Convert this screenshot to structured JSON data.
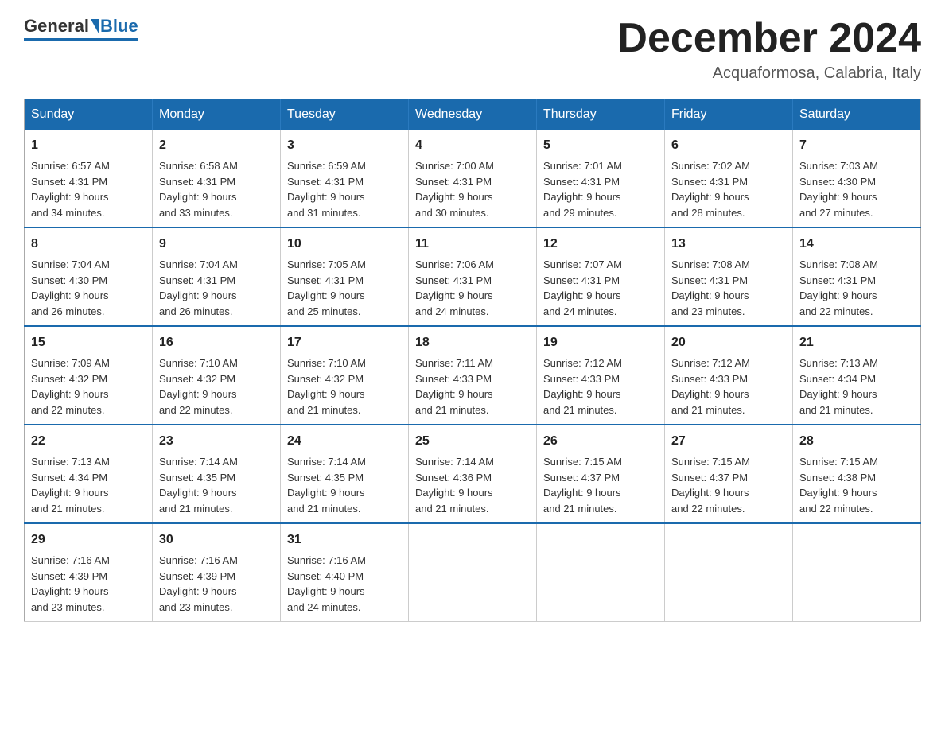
{
  "logo": {
    "general": "General",
    "blue": "Blue"
  },
  "header": {
    "month": "December 2024",
    "location": "Acquaformosa, Calabria, Italy"
  },
  "days_of_week": [
    "Sunday",
    "Monday",
    "Tuesday",
    "Wednesday",
    "Thursday",
    "Friday",
    "Saturday"
  ],
  "weeks": [
    [
      {
        "day": "1",
        "sunrise": "6:57 AM",
        "sunset": "4:31 PM",
        "daylight": "9 hours and 34 minutes."
      },
      {
        "day": "2",
        "sunrise": "6:58 AM",
        "sunset": "4:31 PM",
        "daylight": "9 hours and 33 minutes."
      },
      {
        "day": "3",
        "sunrise": "6:59 AM",
        "sunset": "4:31 PM",
        "daylight": "9 hours and 31 minutes."
      },
      {
        "day": "4",
        "sunrise": "7:00 AM",
        "sunset": "4:31 PM",
        "daylight": "9 hours and 30 minutes."
      },
      {
        "day": "5",
        "sunrise": "7:01 AM",
        "sunset": "4:31 PM",
        "daylight": "9 hours and 29 minutes."
      },
      {
        "day": "6",
        "sunrise": "7:02 AM",
        "sunset": "4:31 PM",
        "daylight": "9 hours and 28 minutes."
      },
      {
        "day": "7",
        "sunrise": "7:03 AM",
        "sunset": "4:30 PM",
        "daylight": "9 hours and 27 minutes."
      }
    ],
    [
      {
        "day": "8",
        "sunrise": "7:04 AM",
        "sunset": "4:30 PM",
        "daylight": "9 hours and 26 minutes."
      },
      {
        "day": "9",
        "sunrise": "7:04 AM",
        "sunset": "4:31 PM",
        "daylight": "9 hours and 26 minutes."
      },
      {
        "day": "10",
        "sunrise": "7:05 AM",
        "sunset": "4:31 PM",
        "daylight": "9 hours and 25 minutes."
      },
      {
        "day": "11",
        "sunrise": "7:06 AM",
        "sunset": "4:31 PM",
        "daylight": "9 hours and 24 minutes."
      },
      {
        "day": "12",
        "sunrise": "7:07 AM",
        "sunset": "4:31 PM",
        "daylight": "9 hours and 24 minutes."
      },
      {
        "day": "13",
        "sunrise": "7:08 AM",
        "sunset": "4:31 PM",
        "daylight": "9 hours and 23 minutes."
      },
      {
        "day": "14",
        "sunrise": "7:08 AM",
        "sunset": "4:31 PM",
        "daylight": "9 hours and 22 minutes."
      }
    ],
    [
      {
        "day": "15",
        "sunrise": "7:09 AM",
        "sunset": "4:32 PM",
        "daylight": "9 hours and 22 minutes."
      },
      {
        "day": "16",
        "sunrise": "7:10 AM",
        "sunset": "4:32 PM",
        "daylight": "9 hours and 22 minutes."
      },
      {
        "day": "17",
        "sunrise": "7:10 AM",
        "sunset": "4:32 PM",
        "daylight": "9 hours and 21 minutes."
      },
      {
        "day": "18",
        "sunrise": "7:11 AM",
        "sunset": "4:33 PM",
        "daylight": "9 hours and 21 minutes."
      },
      {
        "day": "19",
        "sunrise": "7:12 AM",
        "sunset": "4:33 PM",
        "daylight": "9 hours and 21 minutes."
      },
      {
        "day": "20",
        "sunrise": "7:12 AM",
        "sunset": "4:33 PM",
        "daylight": "9 hours and 21 minutes."
      },
      {
        "day": "21",
        "sunrise": "7:13 AM",
        "sunset": "4:34 PM",
        "daylight": "9 hours and 21 minutes."
      }
    ],
    [
      {
        "day": "22",
        "sunrise": "7:13 AM",
        "sunset": "4:34 PM",
        "daylight": "9 hours and 21 minutes."
      },
      {
        "day": "23",
        "sunrise": "7:14 AM",
        "sunset": "4:35 PM",
        "daylight": "9 hours and 21 minutes."
      },
      {
        "day": "24",
        "sunrise": "7:14 AM",
        "sunset": "4:35 PM",
        "daylight": "9 hours and 21 minutes."
      },
      {
        "day": "25",
        "sunrise": "7:14 AM",
        "sunset": "4:36 PM",
        "daylight": "9 hours and 21 minutes."
      },
      {
        "day": "26",
        "sunrise": "7:15 AM",
        "sunset": "4:37 PM",
        "daylight": "9 hours and 21 minutes."
      },
      {
        "day": "27",
        "sunrise": "7:15 AM",
        "sunset": "4:37 PM",
        "daylight": "9 hours and 22 minutes."
      },
      {
        "day": "28",
        "sunrise": "7:15 AM",
        "sunset": "4:38 PM",
        "daylight": "9 hours and 22 minutes."
      }
    ],
    [
      {
        "day": "29",
        "sunrise": "7:16 AM",
        "sunset": "4:39 PM",
        "daylight": "9 hours and 23 minutes."
      },
      {
        "day": "30",
        "sunrise": "7:16 AM",
        "sunset": "4:39 PM",
        "daylight": "9 hours and 23 minutes."
      },
      {
        "day": "31",
        "sunrise": "7:16 AM",
        "sunset": "4:40 PM",
        "daylight": "9 hours and 24 minutes."
      },
      null,
      null,
      null,
      null
    ]
  ],
  "labels": {
    "sunrise": "Sunrise:",
    "sunset": "Sunset:",
    "daylight": "Daylight:"
  }
}
